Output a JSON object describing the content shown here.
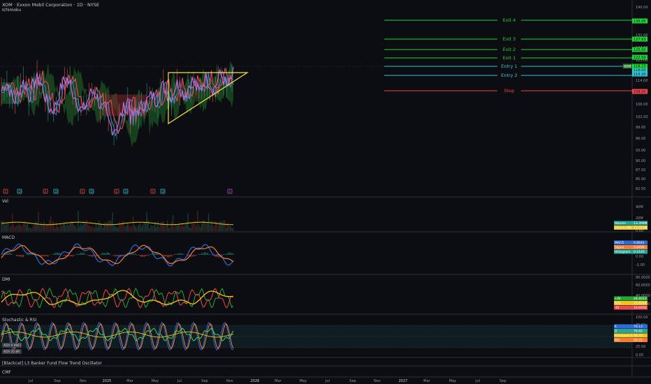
{
  "header": {
    "title": "XOM · Exxon Mobil Corporation · 1D · NYSE",
    "indicator": "Ichimoku"
  },
  "colors": {
    "background": "#0c0d10",
    "exit": "#22d33a",
    "entry": "#2ec4d6",
    "stop": "#f0444f",
    "triangle": "#f2e24a",
    "price": "#c46fe0",
    "ichimoku_red": "#e8484f",
    "ichimoku_blue": "#4b7fe0",
    "cloud_green": "#1f6b2a",
    "cloud_red": "#7a2a2a"
  },
  "chart_data": [
    {
      "type": "line",
      "pane": "price",
      "y_ticks": [
        "140.00",
        "135.00",
        "131.00",
        "127.00",
        "123.00",
        "118.00",
        "114.00",
        "110.00",
        "106.00",
        "102.00",
        "99.00",
        "96.00",
        "93.00",
        "90.00",
        "87.50",
        "85.00",
        "82.50"
      ],
      "price_levels": [
        {
          "label": "Exit 4",
          "price": 135.0,
          "tag": "135.00",
          "kind": "exit"
        },
        {
          "label": "Exit 3",
          "price": 127.93,
          "tag": "127.93",
          "kind": "exit"
        },
        {
          "label": "Exit 2",
          "price": 125.0,
          "tag": "125.00",
          "kind": "exit"
        },
        {
          "label": "Exit 1",
          "price": 122.5,
          "tag": "122.50",
          "kind": "exit"
        },
        {
          "label": "Entry 1",
          "price": 118.5,
          "tag": "118.00",
          "kind": "entry"
        },
        {
          "label": "Entry 2",
          "price": 115.2,
          "tag": "115.20",
          "kind": "entry"
        },
        {
          "label": "Stop",
          "price": 109.0,
          "tag": "109.00",
          "kind": "stop"
        }
      ],
      "current_price": {
        "label": "XOM",
        "value": "118.23"
      },
      "triangle": {
        "points": [
          [
            "2025-05-05",
            98.8
          ],
          [
            "2025-05-05",
            118.0
          ],
          [
            "2025-12-01",
            118.0
          ],
          [
            "2025-05-05",
            98.8
          ],
          [
            "2025-12-01",
            118.0
          ]
        ]
      },
      "event_markers": [
        "E",
        "D",
        "E",
        "D",
        "E",
        "D",
        "E",
        "D",
        "E",
        "D",
        "E"
      ]
    },
    {
      "type": "area",
      "pane": "volume",
      "name": "Vol",
      "y_ticks": [
        "40M",
        "20M",
        "0.00"
      ],
      "legend": [
        {
          "name": "Volume",
          "value": "13.399M",
          "color": "#26a69a"
        },
        {
          "name": "Volume MA",
          "value": "15.023M",
          "color": "#e8c41c"
        }
      ]
    },
    {
      "type": "line",
      "pane": "macd",
      "name": "MACD",
      "y_ticks": [
        "2.00",
        "0.00",
        "-2.00"
      ],
      "legend": [
        {
          "name": "MACD",
          "value": "0.8641",
          "color": "#2f6bd6"
        },
        {
          "name": "Signal",
          "value": "0.6496",
          "color": "#f57c36"
        },
        {
          "name": "Histogram",
          "value": "0.2145",
          "color": "#26a69a"
        }
      ]
    },
    {
      "type": "line",
      "pane": "dmi",
      "name": "DMI",
      "y_ticks": [
        "80.0000",
        "60.0000",
        "40.0000",
        "20.0000"
      ],
      "legend": [
        {
          "name": "+DI",
          "value": "28.4013",
          "color": "#26a63a"
        },
        {
          "name": "ADX",
          "value": "15.6244",
          "color": "#f0c414"
        },
        {
          "name": "-DI",
          "value": "16.9200",
          "color": "#e8484f"
        }
      ]
    },
    {
      "type": "line",
      "pane": "stoch_rsi",
      "name": "Stochastic & RSI",
      "y_ticks": [
        "100.00",
        "75.00",
        "50.00",
        "25.00",
        "0.00"
      ],
      "legend": [
        {
          "name": "K",
          "value": "76.13",
          "color": "#2f6bd6"
        },
        {
          "name": "D",
          "value": "76.45",
          "color": "#26a69a"
        },
        {
          "name": "RSI-based EMA",
          "value": "56.75",
          "color": "#f0c414"
        },
        {
          "name": "RSI",
          "value": "29.22",
          "color": "#f57c36"
        }
      ],
      "left_badges": [
        "ADX 9.9867",
        "ADX 35.89"
      ]
    }
  ],
  "panes": {
    "oscillator": "[Blackcat] L3 Banker Fund Flow Trend Oscillator",
    "cmf": "CMF"
  },
  "x_axis": {
    "labels": [
      "Jul",
      "Sep",
      "Nov",
      "2025",
      "Mar",
      "May",
      "Jul",
      "Sep",
      "Nov",
      "2026",
      "Mar",
      "May",
      "Jul",
      "Sep",
      "Nov",
      "2027",
      "Mar",
      "May",
      "Jul",
      "Sep"
    ]
  }
}
